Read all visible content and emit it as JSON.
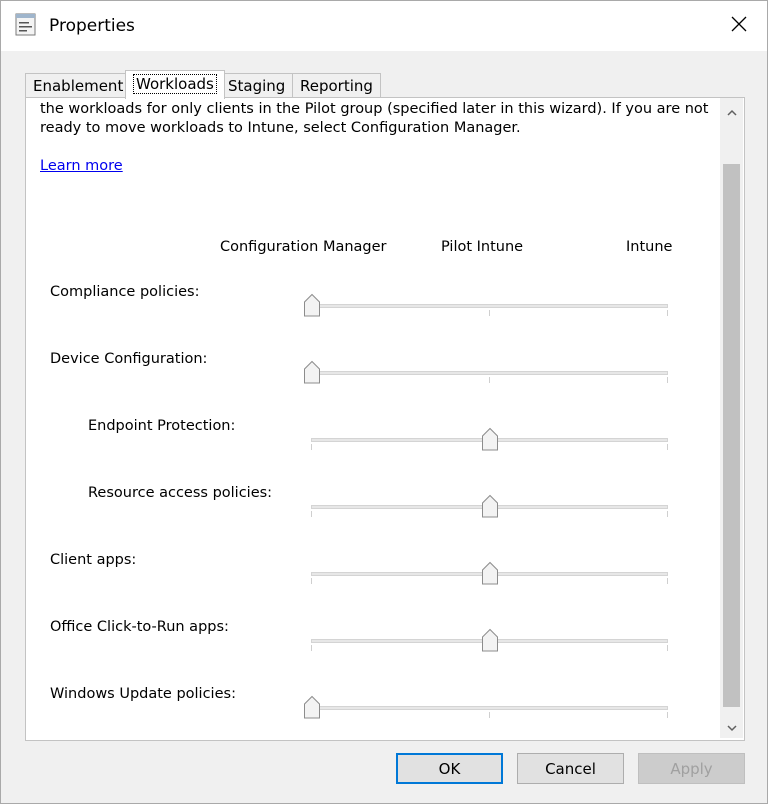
{
  "window": {
    "title": "Properties"
  },
  "tabs": [
    "Enablement",
    "Workloads",
    "Staging",
    "Reporting"
  ],
  "description": "the workloads for only clients in the Pilot group (specified later in this wizard). If you are not ready to move workloads to Intune, select Configuration Manager.",
  "learn_more": "Learn more",
  "columns": [
    "Configuration Manager",
    "Pilot Intune",
    "Intune"
  ],
  "workloads": [
    {
      "label": "Compliance policies:",
      "setting": "Configuration Manager"
    },
    {
      "label": "Device Configuration:",
      "setting": "Configuration Manager"
    },
    {
      "label": "Endpoint Protection:",
      "setting": "Pilot Intune"
    },
    {
      "label": "Resource access policies:",
      "setting": "Pilot Intune"
    },
    {
      "label": "Client apps:",
      "setting": "Pilot Intune"
    },
    {
      "label": "Office Click-to-Run apps:",
      "setting": "Pilot Intune"
    },
    {
      "label": "Windows Update policies:",
      "setting": "Configuration Manager"
    }
  ],
  "buttons": {
    "ok": "OK",
    "cancel": "Cancel",
    "apply": "Apply"
  }
}
